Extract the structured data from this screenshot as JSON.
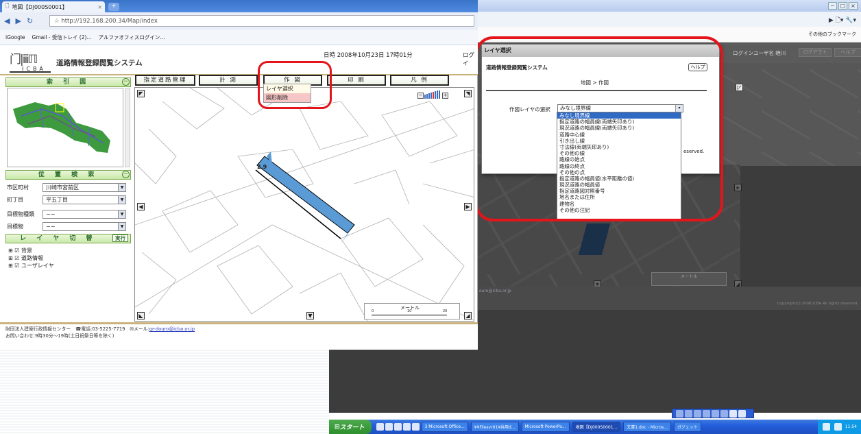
{
  "left_browser": {
    "tab_title": "地図【DJ000S0001】",
    "tab_close": "×",
    "url": "http://192.168.200.34/Map/index",
    "bookmarks": [
      "iGoogle",
      "Gmail - 受信トレイ (2)...",
      "アルファオフィスログイン..."
    ],
    "app_title": "道路情報登録閲覧システム",
    "logo_text": "ICBA",
    "datetime": "日時  2008年10月23日 17時01分",
    "login_cut": "ログイ",
    "index_header": "索 引 図",
    "toolbar": [
      "指定道路管理",
      "計 測",
      "作 図",
      "印 刷",
      "凡 例"
    ],
    "draw_menu": [
      "レイヤ選択",
      "図形削除"
    ],
    "location_header": "位 置 検 索",
    "fields": [
      {
        "label": "市区町村",
        "value": "川崎市宮前区"
      },
      {
        "label": "町丁目",
        "value": "平五丁目"
      },
      {
        "label": "目標物種類",
        "value": "−−"
      },
      {
        "label": "目標物",
        "value": "−−"
      }
    ],
    "layer_header": "レ イ ヤ 切 替",
    "layer_exec": "実行",
    "layers": [
      "背景",
      "道路情報",
      "ユーザレイヤ"
    ],
    "map_label": "2.9",
    "scale_unit": "メートル",
    "scale_ticks": [
      "0",
      "10",
      "20"
    ],
    "footer_line1": "財団法人建築行政情報センター　☎電話:03-5225-7719　✉メール:",
    "footer_email": "gr-douro@icba.or.jp",
    "footer_line2": "お問い合わせ:9時30分〜19時(土日祝祭日等を除く)"
  },
  "right_window": {
    "window_buttons": [
      "−",
      "□",
      "×"
    ],
    "bookmark_folder": "その他のブックマーク",
    "login_user": "ログインユーザ名  蛭川",
    "logout": "ログアウト",
    "help_top": "ヘルプ",
    "scale_unit": "メートル",
    "copyright": "Copyright(c) 2008 ICBA All rights reserved.",
    "reserved_cut": "eserved.",
    "email_cut": "ouro@icba.or.jp"
  },
  "dialog": {
    "title": "レイヤ選択",
    "system_name": "道路情報登録閲覧システム",
    "help_button": "ヘルプ",
    "breadcrumb": "地図 > 作図",
    "select_label": "作図レイヤの選択",
    "selected_value": "みなし境界線",
    "options": [
      "みなし境界線",
      "指定道路の幅員線(両端矢印あり)",
      "現況道路の幅員線(両端矢印あり)",
      "道路中心線",
      "引き出し線",
      "寸法線(両端矢印あり)",
      "その他の線",
      "路線の始点",
      "路線の終点",
      "その他の点",
      "指定道路の幅員値(水平距離の値)",
      "現況道路の幅員値",
      "指定道路図対照番号",
      "地名または住所",
      "建物名",
      "その他の注記"
    ]
  },
  "taskbar": {
    "start": "スタート",
    "items": [
      "3 Microsoft Office...",
      "¥¥Filesvr01¥共用d...",
      "Microsoft PowerPo...",
      "地図【DJ000S0001...",
      "文書1.doc - Micros...",
      "ガジェット"
    ],
    "clock": "11:54"
  }
}
